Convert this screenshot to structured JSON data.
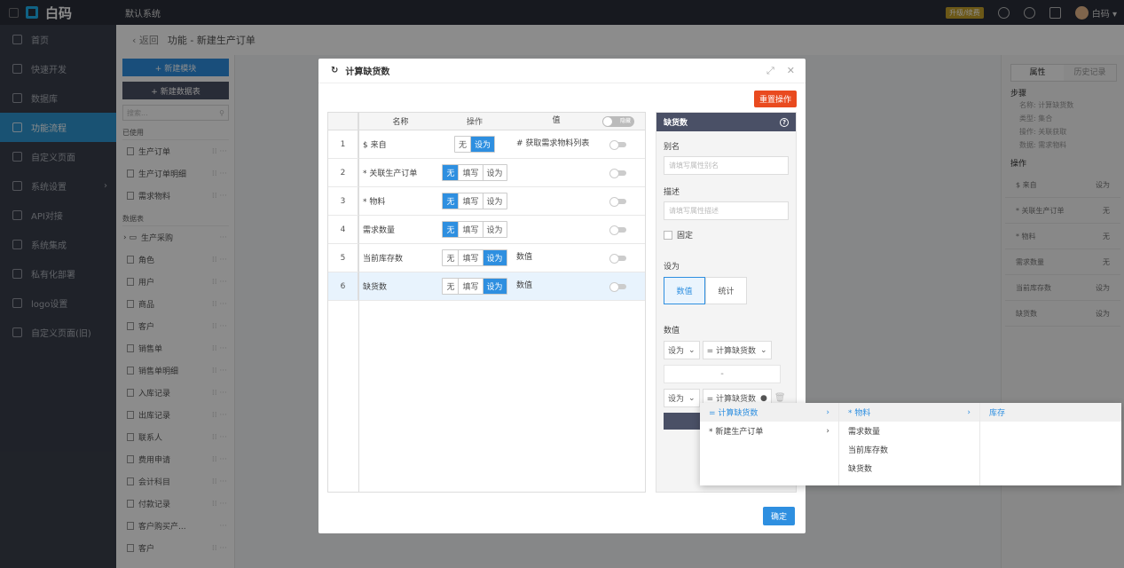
{
  "topbar": {
    "logo": "白码",
    "system": "默认系统",
    "upgrade": "升级/续费",
    "user": "白码 ▾"
  },
  "sidebar": {
    "items": [
      "首页",
      "快速开发",
      "数据库",
      "功能流程",
      "自定义页面",
      "系统设置",
      "API对接",
      "系统集成",
      "私有化部署",
      "logo设置",
      "自定义页面(旧)"
    ]
  },
  "breadcrumb": {
    "back": "‹ 返回",
    "title": "功能 - 新建生产订单"
  },
  "panel2": {
    "new_module": "+ 新建模块",
    "new_table": "+ 新建数据表",
    "search_placeholder": "搜索...",
    "used": "已使用",
    "used_items": [
      "生产订单",
      "生产订单明细",
      "需求物料"
    ],
    "data_tables": "数据表",
    "folder": "生产采购",
    "table_items": [
      "角色",
      "用户",
      "商品",
      "客户",
      "销售单",
      "销售单明细",
      "入库记录",
      "出库记录",
      "联系人",
      "费用申请",
      "会计科目",
      "付款记录",
      "客户购买产...",
      "客户"
    ]
  },
  "right": {
    "tab1": "属性",
    "tab2": "历史记录",
    "step": "步骤",
    "lines": [
      "名称: 计算缺货数",
      "类型: 集合",
      "操作: 关联获取",
      "数据: 需求物料"
    ],
    "op": "操作",
    "rows": [
      [
        "$ 来自",
        "设为"
      ],
      [
        "* 关联生产订单",
        "无"
      ],
      [
        "* 物料",
        "无"
      ],
      [
        "需求数量",
        "无"
      ],
      [
        "当前库存数",
        "设为"
      ],
      [
        "缺货数",
        "设为"
      ]
    ]
  },
  "modal": {
    "title": "计算缺货数",
    "reset": "重置操作",
    "confirm": "确定",
    "headers": {
      "name": "名称",
      "op": "操作",
      "value": "值",
      "toggle": "隐藏"
    },
    "opts": [
      "无",
      "填写",
      "设为"
    ],
    "rows": [
      {
        "n": "1",
        "name": "$ 来自",
        "value": "# 获取需求物料列表"
      },
      {
        "n": "2",
        "name": "* 关联生产订单",
        "value": ""
      },
      {
        "n": "3",
        "name": "* 物料",
        "value": ""
      },
      {
        "n": "4",
        "name": "需求数量",
        "value": ""
      },
      {
        "n": "5",
        "name": "当前库存数",
        "value": "数值"
      },
      {
        "n": "6",
        "name": "缺货数",
        "value": "数值"
      }
    ],
    "pane": {
      "title": "缺货数",
      "alias": "别名",
      "alias_ph": "请填写属性别名",
      "desc": "描述",
      "desc_ph": "请填写属性描述",
      "fixed": "固定",
      "setas": "设为",
      "card1": "数值",
      "card2": "统计",
      "value_label": "数值",
      "sel1": "设为",
      "sel2": "= 计算缺货数",
      "minus": "-"
    }
  },
  "cascade": {
    "col1": [
      "= 计算缺货数",
      "* 新建生产订单"
    ],
    "col2": [
      "* 物料",
      "需求数量",
      "当前库存数",
      "缺货数"
    ],
    "col3": [
      "库存"
    ]
  }
}
